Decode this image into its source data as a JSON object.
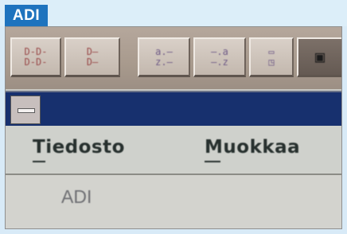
{
  "badge": {
    "label": "ADI"
  },
  "toolbar": {
    "buttons": [
      {
        "icon": "merge-records-icon",
        "glyph": "D-D-\nD-D-"
      },
      {
        "icon": "record-list-icon",
        "glyph": "D—\nD—"
      },
      {
        "icon": "sort-ascending-icon",
        "glyph": "a.—\nz.—"
      },
      {
        "icon": "sort-descending-icon",
        "glyph": "—.a\n—.z"
      },
      {
        "icon": "find-icon",
        "glyph": "▭\n◳"
      },
      {
        "icon": "window-icon",
        "glyph": "▣"
      }
    ]
  },
  "menu": {
    "items": [
      {
        "label": "Tiedosto"
      },
      {
        "label": "Muokkaa"
      }
    ]
  },
  "document": {
    "label": "ADI"
  },
  "colors": {
    "badge_bg": "#1e73be",
    "title_bar": "#17306e",
    "toolbar": "#a89a8d"
  }
}
